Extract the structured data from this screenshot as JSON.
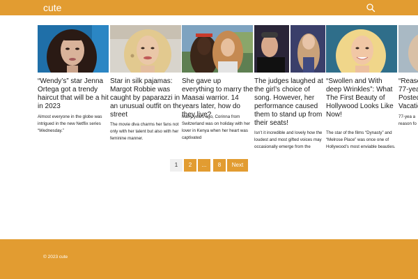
{
  "site": {
    "logo": "cute",
    "search_icon": "search-icon",
    "brand_color": "#e29c31"
  },
  "articles": [
    {
      "title": "“Wendy’s” star Jenna Ortega got a trendy haircut that will be a hit in 2023",
      "excerpt": "Almost everyone in the globe was intrigued in the new Netflix series “Wednesday.”"
    },
    {
      "title": "Star in silk pajamas: Margot Robbie was caught by paparazzi in an unusual outfit on the street",
      "excerpt": "The movie diva charms her fans not only with her talent but also with her feminine manner."
    },
    {
      "title": "She gave up everything to marry the Maasai warrior. 14 years later, how do they live?",
      "excerpt": "Many years ago, Corinna from Switzerland was on holiday with her lover in Kenya when her heart was captivated"
    },
    {
      "title": "The judges laughed at the girl’s choice of song. However, her performance caused them to stand up from their seats!",
      "excerpt": "Isn’t it incredible and lovely how the loudest and most gifted voices may occasionally emerge from the"
    },
    {
      "title": "“Swollen and With deep Wrinkles”: What The First Beauty of Hollywood Looks Like Now!",
      "excerpt": "The star of the films “Dynasty” and “Melrose Place” was once one of Hollywood’s most enviable beauties."
    },
    {
      "title": "“Reaso 77-yea Posted Vacatic",
      "excerpt": "77-yea a reason fo"
    }
  ],
  "pagination": {
    "current": "1",
    "pages": [
      "2",
      "...",
      "8"
    ],
    "next_label": "Next"
  },
  "footer": {
    "copyright": "© 2023 cute"
  }
}
